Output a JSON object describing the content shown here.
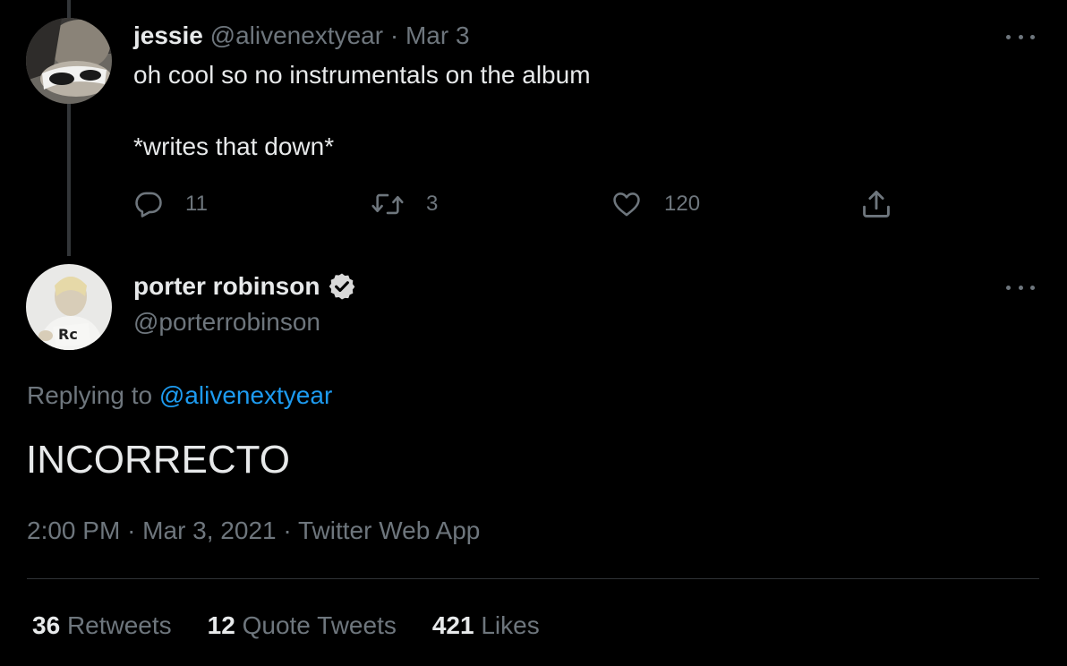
{
  "parent_tweet": {
    "author_name": "jessie",
    "author_handle": "@alivenextyear",
    "separator": "·",
    "date": "Mar 3",
    "text_line_1": "oh cool so no instrumentals on the album",
    "text_line_2": "*writes that down*",
    "reply_count": "11",
    "retweet_count": "3",
    "like_count": "120"
  },
  "main_tweet": {
    "author_name": "porter robinson",
    "author_handle": "@porterrobinson",
    "verified": true,
    "replying_prefix": "Replying to",
    "replying_to": "@alivenextyear",
    "text": "INCORRECTO",
    "time": "2:00 PM",
    "separator": "·",
    "date": "Mar 3, 2021",
    "source": "Twitter Web App"
  },
  "stats": {
    "retweets_count": "36",
    "retweets_label": "Retweets",
    "quote_tweets_count": "12",
    "quote_tweets_label": "Quote Tweets",
    "likes_count": "421",
    "likes_label": "Likes"
  },
  "icons": {
    "reply": "reply-icon",
    "retweet": "retweet-icon",
    "like": "heart-icon",
    "share": "share-icon",
    "verified": "verified-badge-icon",
    "more": "more-options-icon"
  },
  "colors": {
    "background": "#000000",
    "primary_text": "#e7e9ea",
    "secondary_text": "#6e767d",
    "link": "#1d9bf0",
    "divider": "#2f3336"
  }
}
